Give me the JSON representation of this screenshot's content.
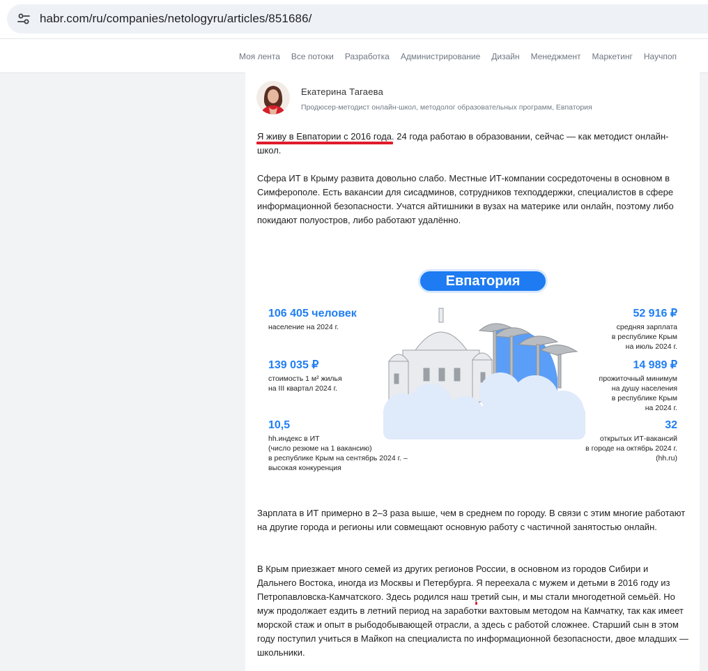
{
  "browser": {
    "url": "habr.com/ru/companies/netologyru/articles/851686/"
  },
  "nav": {
    "items": [
      "Моя лента",
      "Все потоки",
      "Разработка",
      "Администрирование",
      "Дизайн",
      "Менеджмент",
      "Маркетинг",
      "Научпоп"
    ]
  },
  "author": {
    "name": "Екатерина Тагаева",
    "role": "Продюсер-методист онлайн-школ, методолог образовательных программ, Евпатория"
  },
  "paragraphs": {
    "p1": {
      "hl": "Я живу в Евпатории с 2016 года",
      "rest": ". 24 года работаю в образовании, сейчас — как методист онлайн-школ."
    },
    "p2": "Сфера ИТ в Крыму развита довольно слабо. Местные ИТ-компании сосредоточены в основном в Симферополе. Есть вакансии для сисадминов, сотрудников техподдержки, специалистов в сфере информационной безопасности. Учатся айтишники в вузах на материке или онлайн, поэтому либо покидают полуостров, либо работают удалённо.",
    "p3": "Зарплата в ИТ примерно в 2–3 раза выше, чем в среднем по городу. В связи с этим многие работают на другие города и регионы или совмещают основную работу с частичной занятостью онлайн.",
    "p4": {
      "a": "В Крым приезжает много семей из других регионов России, в основном из городов Сибири и Дальнего Востока, иногда из Москвы и Петербурга. ",
      "hl": "Я переехала с мужем и детьми в 2016 году из Петропавловска-Камчатского",
      "b": ". Здесь родился наш третий сын, и мы стали многодетной семьёй. Но муж продолжает ездить в летний период на заработки вахтовым методом на Камчатку, так как имеет морской стаж и опыт в рыбодобывающей отрасли, а здесь с работой сложнее. Старший сын в этом году поступил учиться в Майкоп на специалиста по информационной безопасности, двое младших — школьники."
    }
  },
  "infographic": {
    "title": "Евпатория",
    "left": [
      {
        "value": "106 405 человек",
        "label": "население на 2024 г."
      },
      {
        "value": "139 035 ₽",
        "label": "стоимость 1 м² жилья\nна III квартал 2024 г."
      },
      {
        "value": "10,5",
        "label": "hh.индекс в ИТ\n(число резюме на 1 вакансию)\nв республике Крым на сентябрь 2024 г. –\nвысокая конкуренция"
      }
    ],
    "right": [
      {
        "value": "52 916 ₽",
        "label": "средняя зарплата\nв республике Крым\nна июль 2024 г."
      },
      {
        "value": "14 989 ₽",
        "label": "прожиточный минимум\nна душу населения\nв республике Крым\nна 2024 г."
      },
      {
        "value": "32",
        "label": "открытых ИТ-вакансий\nв городе на октябрь 2024 г.\n(hh.ru)"
      }
    ]
  },
  "colors": {
    "accent": "#1f7ef3",
    "highlight": "#e01c2b"
  }
}
